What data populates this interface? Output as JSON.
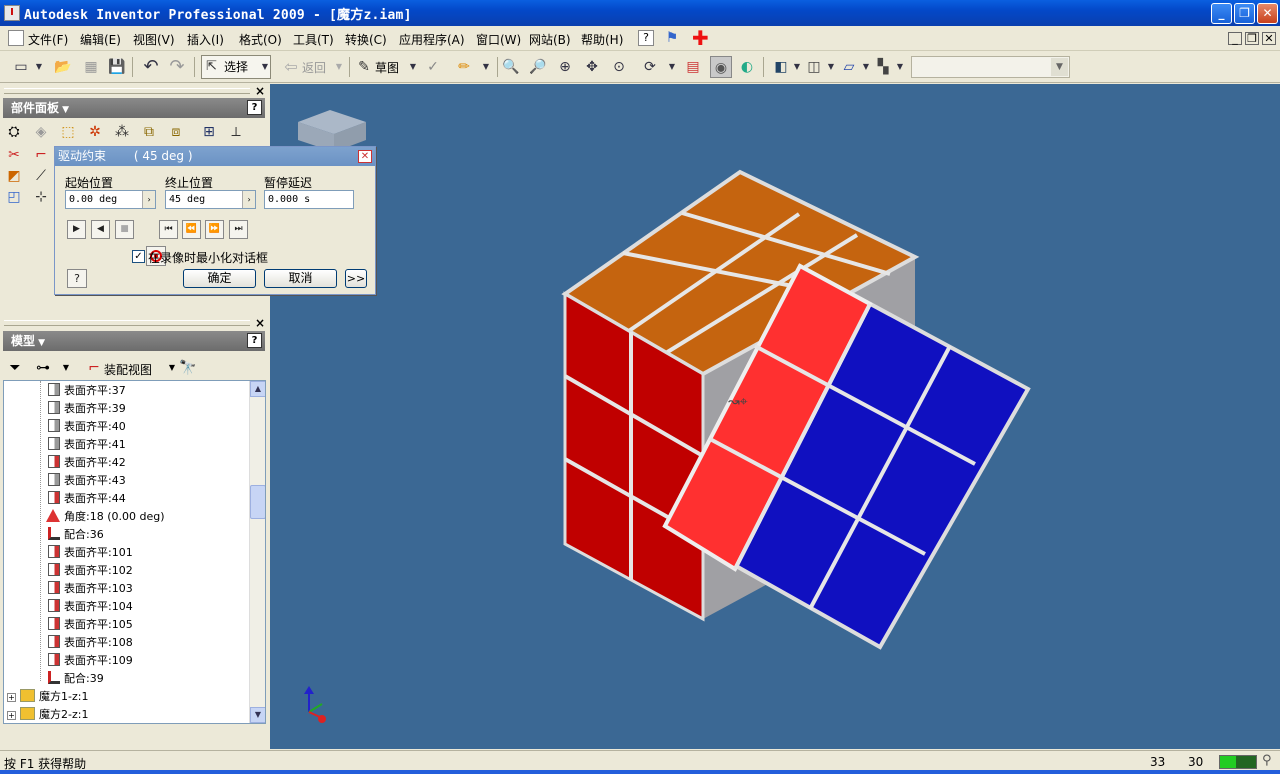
{
  "window": {
    "title": "Autodesk Inventor Professional 2009 - [魔方z.iam]",
    "buttons": [
      "_",
      "❐",
      "✕"
    ]
  },
  "menu": {
    "items": [
      "文件(F)",
      "编辑(E)",
      "视图(V)",
      "插入(I)",
      "格式(O)",
      "工具(T)",
      "转换(C)",
      "应用程序(A)",
      "窗口(W)",
      "网站(B)",
      "帮助(H)"
    ]
  },
  "toolbar": {
    "select_label": "选择",
    "back_label": "返回",
    "sketch_label": "草图",
    "style_value": ""
  },
  "panel_bar": {
    "title": "部件面板",
    "help": "?"
  },
  "dialog": {
    "title": "驱动约束",
    "title_value": "( 45 deg )",
    "start_label": "起始位置",
    "end_label": "终止位置",
    "pause_label": "暂停延迟",
    "start_value": "0.00 deg",
    "end_value": "45 deg",
    "pause_value": "0.000 s",
    "checkbox_label": "在录像时最小化对话框",
    "checkbox_checked": true,
    "ok_label": "确定",
    "cancel_label": "取消",
    "more_label": ">>",
    "help": "?"
  },
  "model_browser": {
    "title": "模型",
    "view_label": "装配视图",
    "help": "?",
    "rows": [
      {
        "label": "表面齐平:37",
        "icon": "flush-icon"
      },
      {
        "label": "表面齐平:39",
        "icon": "flush-icon"
      },
      {
        "label": "表面齐平:40",
        "icon": "flush-icon"
      },
      {
        "label": "表面齐平:41",
        "icon": "flush-icon"
      },
      {
        "label": "表面齐平:42",
        "icon": "flush-icon-red"
      },
      {
        "label": "表面齐平:43",
        "icon": "flush-icon"
      },
      {
        "label": "表面齐平:44",
        "icon": "flush-icon-red"
      },
      {
        "label": "角度:18 (0.00 deg)",
        "icon": "angle-icon"
      },
      {
        "label": "配合:36",
        "icon": "mate-icon"
      },
      {
        "label": "表面齐平:101",
        "icon": "flush-icon-red"
      },
      {
        "label": "表面齐平:102",
        "icon": "flush-icon-red"
      },
      {
        "label": "表面齐平:103",
        "icon": "flush-icon-red"
      },
      {
        "label": "表面齐平:104",
        "icon": "flush-icon-red"
      },
      {
        "label": "表面齐平:105",
        "icon": "flush-icon-red"
      },
      {
        "label": "表面齐平:108",
        "icon": "flush-icon-red"
      },
      {
        "label": "表面齐平:109",
        "icon": "flush-icon-red"
      },
      {
        "label": "配合:39",
        "icon": "mate-icon"
      },
      {
        "label": "魔方1-z:1",
        "icon": "assembly-icon"
      },
      {
        "label": "魔方2-z:1",
        "icon": "assembly-icon"
      }
    ]
  },
  "status": {
    "message": "按 F1 获得帮助",
    "count_a": "33",
    "count_b": "30"
  },
  "colors": {
    "viewport_bg": "#3b6894",
    "cube_top": "#c5640f",
    "cube_front": "#c00000",
    "cube_red_strip": "#ff3030",
    "cube_blue": "#1010c0",
    "cube_gray": "#b0b0b0"
  }
}
